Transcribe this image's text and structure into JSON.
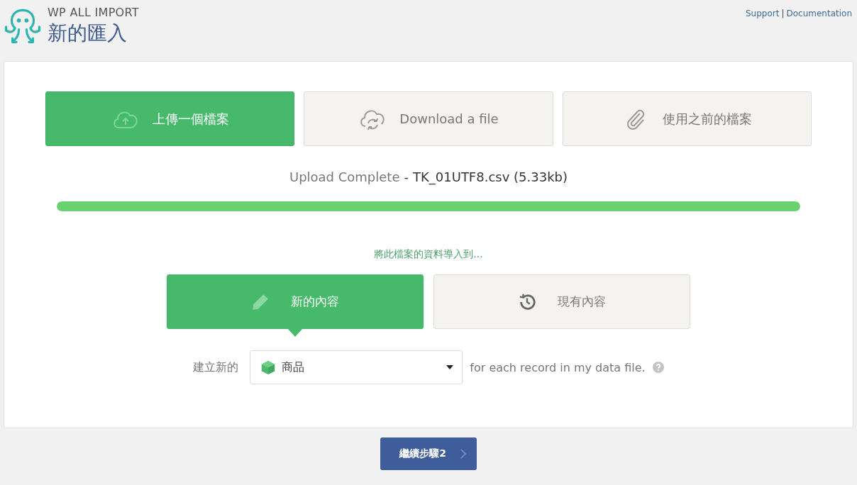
{
  "header": {
    "brand": "WP ALL IMPORT",
    "title": "新的匯入",
    "links": [
      "Support",
      "Documentation"
    ],
    "link_separator": "|"
  },
  "source_tabs": [
    {
      "kind": "upload",
      "label": "上傳一個檔案",
      "selected": true
    },
    {
      "kind": "download",
      "label": "Download a file",
      "selected": false
    },
    {
      "kind": "previous",
      "label": "使用之前的檔案",
      "selected": false
    }
  ],
  "upload_status": {
    "label": "Upload Complete",
    "separator": "-",
    "file": "TK_01UTF8.csv (5.33kb)",
    "level": 1
  },
  "import_prompt": "將此檔案的資料導入到...",
  "targets": [
    {
      "kind": "new",
      "label": "新的內容",
      "selected": true
    },
    {
      "kind": "existing",
      "label": "現有內容",
      "selected": false
    }
  ],
  "create_row": {
    "label": "建立新的",
    "select_value": "商品",
    "suffix": "for each record in my data file."
  },
  "continue_button": "繼續步驟2"
}
